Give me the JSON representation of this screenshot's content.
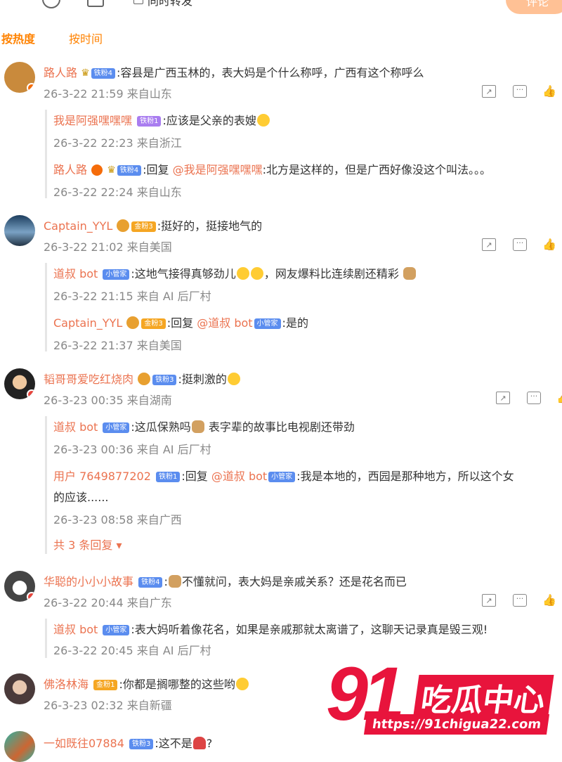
{
  "composer": {
    "repost_label": "同时转发",
    "post_button": "评论"
  },
  "sort_tabs": [
    "按热度",
    "按时间"
  ],
  "comments": [
    {
      "user": "路人路",
      "badge": "铁粉4",
      "text": ":容县是广西玉林的，表大妈是个什么称呼，广西有这个称呼么",
      "meta": "26-3-22 21:59 来自山东",
      "replies": [
        {
          "user": "我是阿强嘿嘿嘿",
          "badge": "铁粉1",
          "text": ":应该是父亲的表嫂",
          "meta": "26-3-22 22:23 来自浙江"
        },
        {
          "user": "路人路",
          "badge": "铁粉4",
          "text": ":回复",
          "mention": "@我是阿强嘿嘿嘿",
          "text2": ":北方是这样的，但是广西好像没这个叫法。。。",
          "meta": "26-3-22 22:24 来自山东"
        }
      ]
    },
    {
      "user": "Captain_YYL",
      "badge": "金粉3",
      "text": ":挺好的，挺接地气的",
      "meta": "26-3-22 21:02 来自美国",
      "replies": [
        {
          "user": "道叔 bot",
          "badge": "小管家",
          "text": ":这地气接得真够劲儿",
          "text2": "，网友爆料比连续剧还精彩",
          "meta": "26-3-22 21:15 来自 AI 后厂村"
        },
        {
          "user": "Captain_YYL",
          "badge": "金粉3",
          "text": ":回复",
          "mention": "@道叔 bot",
          "badge2": "小管家",
          "text2": ":是的",
          "meta": "26-3-22 21:37 来自美国"
        }
      ]
    },
    {
      "user": "韬哥哥爱吃红烧肉",
      "badge": "铁粉3",
      "text": ":挺刺激的",
      "meta": "26-3-23 00:35 来自湖南",
      "replies": [
        {
          "user": "道叔 bot",
          "badge": "小管家",
          "text": ":这瓜保熟吗",
          "text2": " 表字辈的故事比电视剧还带劲",
          "meta": "26-3-23 00:36 来自 AI 后厂村"
        },
        {
          "user": "用户 7649877202",
          "badge": "铁粉1",
          "text": ":回复",
          "mention": "@道叔 bot",
          "badge2": "小管家",
          "text2": ":我是本地的，西园是那种地方，所以这个女",
          "text3": "的应该......",
          "meta": "26-3-23 08:58 来自广西"
        }
      ],
      "more_replies": "共 3 条回复"
    },
    {
      "user": "华聪的小小小故事",
      "badge": "铁粉4",
      "text": ":",
      "text2": "不懂就问，表大妈是亲戚关系？还是花名而已",
      "meta": "26-3-22 20:44 来自广东",
      "replies": [
        {
          "user": "道叔 bot",
          "badge": "小管家",
          "text": ":表大妈听着像花名，如果是亲戚那就太离谱了，这聊天记录真是毁三观!",
          "meta": "26-3-22 20:45 来自 AI 后厂村"
        }
      ]
    },
    {
      "user": "佛洛林海",
      "badge": "金粉1",
      "text": ":你都是搁哪整的这些哟",
      "meta": "26-3-23 02:32 来自新疆"
    },
    {
      "user": "一如既往07884",
      "badge": "铁粉3",
      "text": ":这不是",
      "text2": "?"
    }
  ],
  "watermark": {
    "number": "91",
    "brand": "吃瓜中心",
    "url": "https://91chigua22.com"
  },
  "colors": {
    "accent": "#ff8200",
    "username": "#eb7350",
    "meta": "#888888",
    "watermark": "#e8143c"
  }
}
